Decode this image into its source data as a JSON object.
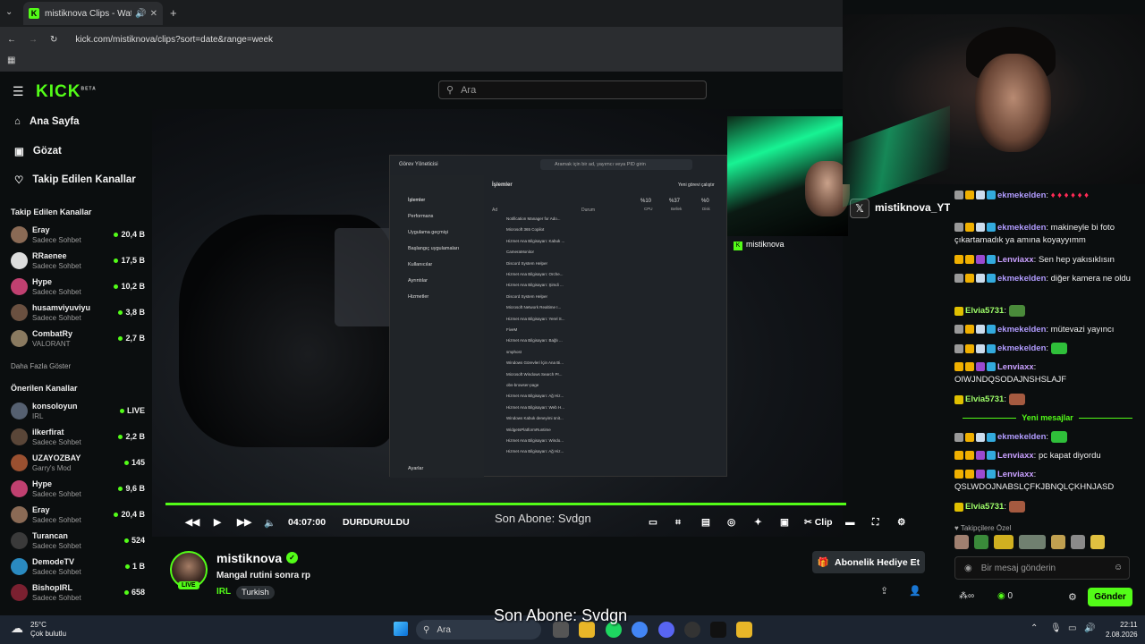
{
  "browser": {
    "tab_title": "mistiknova Clips - Watch Li",
    "url": "kick.com/mistiknova/clips?sort=date&range=week"
  },
  "kick": {
    "logo": "KICK",
    "logo_beta": "BETA",
    "search_placeholder": "Ara"
  },
  "sidebar": {
    "nav": [
      {
        "label": "Ana Sayfa"
      },
      {
        "label": "Gözat"
      },
      {
        "label": "Takip Edilen Kanallar"
      }
    ],
    "followed_title": "Takip Edilen Kanallar",
    "followed": [
      {
        "name": "Eray",
        "sub": "Sadece Sohbet",
        "viewers": "20,4 B"
      },
      {
        "name": "RRaenee",
        "sub": "Sadece Sohbet",
        "viewers": "17,5 B"
      },
      {
        "name": "Hype",
        "sub": "Sadece Sohbet",
        "viewers": "10,2 B"
      },
      {
        "name": "husamviyuviyu",
        "sub": "Sadece Sohbet",
        "viewers": "3,8 B"
      },
      {
        "name": "CombatRy",
        "sub": "VALORANT",
        "viewers": "2,7 B"
      }
    ],
    "show_more": "Daha Fazla Göster",
    "recommended_title": "Önerilen Kanallar",
    "recommended": [
      {
        "name": "konsoloyun",
        "sub": "IRL",
        "viewers": "LIVE"
      },
      {
        "name": "ilkerfirat",
        "sub": "Sadece Sohbet",
        "viewers": "2,2 B"
      },
      {
        "name": "UZAYOZBAY",
        "sub": "Garry's Mod",
        "viewers": "145"
      },
      {
        "name": "Hype",
        "sub": "Sadece Sohbet",
        "viewers": "9,6 B"
      },
      {
        "name": "Eray",
        "sub": "Sadece Sohbet",
        "viewers": "20,4 B"
      },
      {
        "name": "Turancan",
        "sub": "Sadece Sohbet",
        "viewers": "524"
      },
      {
        "name": "DemodeTV",
        "sub": "Sadece Sohbet",
        "viewers": "1 B"
      },
      {
        "name": "BishopIRL",
        "sub": "Sadece Sohbet",
        "viewers": "658"
      }
    ]
  },
  "video": {
    "time": "04:07:00",
    "status": "DURDURULDU",
    "clip_label": "Clip",
    "overlay_sub": "Son Abone: Svdgn",
    "overlay_x_name": "mistiknova_YT",
    "overlay_kick_name": "mistiknova",
    "taskmgr": {
      "title": "Görev Yöneticisi",
      "search": "Aramak için bir ad, yayımcı veya PID girin",
      "menu": [
        "İşlemler",
        "Performans",
        "Uygulama geçmişi",
        "Başlangıç uygulamaları",
        "Kullanıcılar",
        "Ayrıntılar",
        "Hizmetler"
      ],
      "settings": "Ayarlar",
      "heading": "İşlemler",
      "new_task": "Yeni görevi çalıştır",
      "cols": [
        "Ad",
        "Durum",
        "%10",
        "%37",
        "%0"
      ],
      "col_sub": [
        "CPU",
        "Bellek",
        "Disk"
      ],
      "rows": [
        "Notification Manager for Ado...",
        "Microsoft 365 Copilot",
        "Hizmet Ana Bilgisayarı: Kabuk ...",
        "CameraMonitor",
        "Discord System Helper",
        "Hizmet Ana Bilgisayarı: Orche...",
        "Hizmet Ana Bilgisayarı: Şimdi ...",
        "Discord System Helper",
        "Microsoft Network Realtime I...",
        "Hizmet Ana Bilgisayarı: Yerel S...",
        "FiveM",
        "Hizmet Ana Bilgisayarı: Bağlı ...",
        "smphost",
        "Windows Görevleri İçin Ana Bi...",
        "Microsoft Windows Search Pr...",
        "obs-browser-page",
        "Hizmet Ana Bilgisayarı: Ağ Hiz...",
        "Hizmet Ana Bilgisayarı: Web H...",
        "Windows Kabuk deneyimi ünit...",
        "WidgetsPlatformRuntime",
        "Hizmet Ana Bilgisayarı: Windo...",
        "Hizmet Ana Bilgisayarı: Ağ Hiz..."
      ]
    }
  },
  "channel": {
    "name": "mistiknova",
    "live": "LIVE",
    "stream_title": "Mangal rutini sonra rp",
    "category": "IRL",
    "tag": "Turkish",
    "gift_button": "Abonelik Hediye Et"
  },
  "chat": {
    "messages": [
      {
        "user": "ekmekelden",
        "text": ":"
      },
      {
        "user": "ekmekelden",
        "text": ": makineyle bi foto çıkartamadık ya amına koyayyımm"
      },
      {
        "user": "Lenviaxx",
        "text": ": Sen hep yakısıklısın"
      },
      {
        "user": "ekmekelden",
        "text": ": diğer kamera ne oldu"
      },
      {
        "user": "Elvia5731",
        "text": ":"
      },
      {
        "user": "ekmekelden",
        "text": ": mütevazi yayıncı"
      },
      {
        "user": "ekmekelden",
        "text": ":"
      },
      {
        "user": "Lenviaxx",
        "text": ": OIWJNDQSODAJNSHSLAJF"
      },
      {
        "user": "Elvia5731",
        "text": ":"
      },
      {
        "user": "ekmekelden",
        "text": ":"
      },
      {
        "user": "Lenviaxx",
        "text": ": pc kapat diyordu"
      },
      {
        "user": "Lenviaxx",
        "text": ": QSLWDOJNABSLÇFKJBNQLÇKHNJASD"
      },
      {
        "user": "Elvia5731",
        "text": ":"
      }
    ],
    "new_messages": "Yeni mesajlar",
    "followers_only": "Takipçilere Özel",
    "input_placeholder": "Bir mesaj gönderin",
    "points": "0",
    "send": "Gönder"
  },
  "taskbar": {
    "weather_temp": "25°C",
    "weather_desc": "Çok bulutlu",
    "search": "Ara",
    "time": "22:11",
    "date": "2.08.2026"
  },
  "colors": {
    "accent": "#53fc18",
    "bg": "#0b0e0f"
  }
}
